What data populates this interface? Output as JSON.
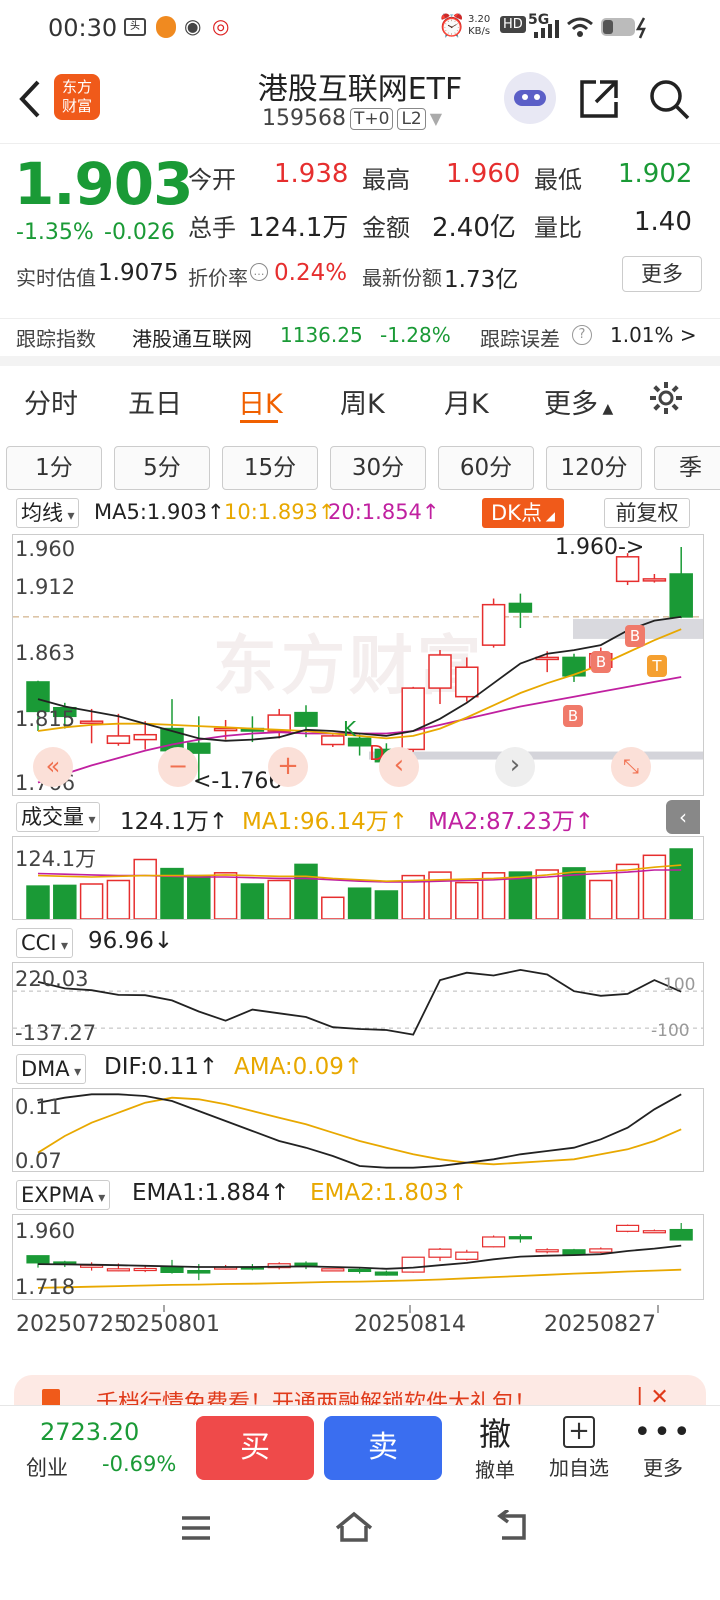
{
  "status": {
    "time": "00:30",
    "net_speed_top": "3.20",
    "net_speed_bot": "KB/s",
    "hd": "HD",
    "signal": "5G"
  },
  "header": {
    "logo_line1": "东方",
    "logo_line2": "财富",
    "title": "港股互联网ETF",
    "code": "159568",
    "tag1": "T+0",
    "tag2": "L2"
  },
  "quote": {
    "price": "1.903",
    "change_pct": "-1.35%",
    "change": "-0.026",
    "open_label": "今开",
    "open": "1.938",
    "high_label": "最高",
    "high": "1.960",
    "low_label": "最低",
    "low": "1.902",
    "vol_label": "总手",
    "vol": "124.1万",
    "amt_label": "金额",
    "amt": "2.40亿",
    "ratio_label": "量比",
    "ratio": "1.40",
    "iopv_label": "实时估值",
    "iopv": "1.9075",
    "premium_label": "折价率",
    "premium": "0.24%",
    "shares_label": "最新份额",
    "shares": "1.73亿",
    "more": "更多"
  },
  "track": {
    "label": "跟踪指数",
    "index": "港股通互联网",
    "value": "1136.25",
    "change": "-1.28%",
    "err_label": "跟踪误差",
    "err": "1.01% >"
  },
  "tabs": [
    "分时",
    "五日",
    "日K",
    "周K",
    "月K",
    "更多"
  ],
  "periods": [
    "1分",
    "5分",
    "15分",
    "30分",
    "60分",
    "120分",
    "季"
  ],
  "kline": {
    "selector": "均线",
    "ma5": "MA5:1.903↑",
    "ma10": "10:1.893↑",
    "ma20": "20:1.854↑",
    "dk": "DK点",
    "adj": "前复权",
    "y_top": "1.960",
    "y2": "1.912",
    "y3": "1.863",
    "y4": "1.815",
    "y_bot": "1.766",
    "hi_note": "1.960->",
    "lo_note": "<-1.766",
    "k_mark": "K",
    "d_mark": "D",
    "b_mark": "B",
    "t_mark": "T",
    "watermark": "东方财富"
  },
  "volume": {
    "selector": "成交量",
    "value": "124.1万↑",
    "ma1": "MA1:96.14万↑",
    "ma2": "MA2:87.23万↑",
    "y_top": "124.1万"
  },
  "cci": {
    "selector": "CCI",
    "value": "96.96↓",
    "y_top": "220.03",
    "y_bot": "-137.27",
    "r_top": "100",
    "r_bot": "-100"
  },
  "dma": {
    "selector": "DMA",
    "dif": "DIF:0.11↑",
    "ama": "AMA:0.09↑",
    "y_top": "0.11",
    "y_bot": "0.07"
  },
  "expma": {
    "selector": "EXPMA",
    "ema1": "EMA1:1.884↑",
    "ema2": "EMA2:1.803↑",
    "y_top": "1.960",
    "y_bot": "1.718"
  },
  "dates": [
    "20250725",
    "20250801",
    "20250814",
    "20250827"
  ],
  "banner": {
    "text": "千档行情免费看！开通两融解锁软件大礼包！"
  },
  "bottom": {
    "index_value": "2723.20",
    "index_name": "创业",
    "index_change": "-0.69%",
    "buy": "买",
    "sell": "卖",
    "cancel_big": "撤",
    "cancel": "撤单",
    "add": "加自选",
    "more": "更多"
  },
  "colors": {
    "up": "#e62e2e",
    "down": "#1a9a36",
    "ma5": "#222222",
    "ma10": "#e8a800",
    "ma20": "#c020a0",
    "accent": "#f06000",
    "buy": "#ef4a4a",
    "sell": "#3a6ef0"
  },
  "chart_data": {
    "type": "candlestick",
    "dates_shown": [
      "20250725",
      "20250801",
      "20250814",
      "20250827"
    ],
    "ylim": [
      1.766,
      1.96
    ],
    "candles": [
      {
        "o": 1.85,
        "c": 1.826,
        "h": 1.851,
        "l": 1.81
      },
      {
        "o": 1.829,
        "c": 1.822,
        "h": 1.833,
        "l": 1.812
      },
      {
        "o": 1.818,
        "c": 1.818,
        "h": 1.828,
        "l": 1.8
      },
      {
        "o": 1.8,
        "c": 1.806,
        "h": 1.824,
        "l": 1.798
      },
      {
        "o": 1.803,
        "c": 1.807,
        "h": 1.818,
        "l": 1.795
      },
      {
        "o": 1.812,
        "c": 1.794,
        "h": 1.836,
        "l": 1.79
      },
      {
        "o": 1.8,
        "c": 1.792,
        "h": 1.822,
        "l": 1.768
      },
      {
        "o": 1.811,
        "c": 1.812,
        "h": 1.819,
        "l": 1.803
      },
      {
        "o": 1.812,
        "c": 1.81,
        "h": 1.822,
        "l": 1.801
      },
      {
        "o": 1.81,
        "c": 1.823,
        "h": 1.828,
        "l": 1.804
      },
      {
        "o": 1.825,
        "c": 1.814,
        "h": 1.831,
        "l": 1.805
      },
      {
        "o": 1.799,
        "c": 1.806,
        "h": 1.807,
        "l": 1.797
      },
      {
        "o": 1.804,
        "c": 1.798,
        "h": 1.807,
        "l": 1.79
      },
      {
        "o": 1.795,
        "c": 1.785,
        "h": 1.8,
        "l": 1.783
      },
      {
        "o": 1.795,
        "c": 1.845,
        "h": 1.846,
        "l": 1.793
      },
      {
        "o": 1.845,
        "c": 1.872,
        "h": 1.876,
        "l": 1.832
      },
      {
        "o": 1.838,
        "c": 1.862,
        "h": 1.87,
        "l": 1.834
      },
      {
        "o": 1.88,
        "c": 1.913,
        "h": 1.918,
        "l": 1.878
      },
      {
        "o": 1.914,
        "c": 1.907,
        "h": 1.922,
        "l": 1.894
      },
      {
        "o": 1.87,
        "c": 1.87,
        "h": 1.875,
        "l": 1.858
      },
      {
        "o": 1.87,
        "c": 1.855,
        "h": 1.873,
        "l": 1.85
      },
      {
        "o": 1.862,
        "c": 1.873,
        "h": 1.878,
        "l": 1.859
      },
      {
        "o": 1.932,
        "c": 1.952,
        "h": 1.955,
        "l": 1.929
      },
      {
        "o": 1.934,
        "c": 1.934,
        "h": 1.938,
        "l": 1.931
      },
      {
        "o": 1.938,
        "c": 1.903,
        "h": 1.96,
        "l": 1.902
      }
    ],
    "ma5": [
      1.836,
      1.83,
      1.826,
      1.822,
      1.816,
      1.81,
      1.804,
      1.802,
      1.803,
      1.805,
      1.811,
      1.81,
      1.808,
      1.806,
      1.81,
      1.82,
      1.833,
      1.849,
      1.865,
      1.873,
      1.876,
      1.88,
      1.892,
      1.9,
      1.903
    ],
    "ma10": [
      1.81,
      1.813,
      1.815,
      1.816,
      1.816,
      1.815,
      1.814,
      1.813,
      1.812,
      1.811,
      1.81,
      1.808,
      1.806,
      1.804,
      1.806,
      1.812,
      1.821,
      1.831,
      1.841,
      1.849,
      1.856,
      1.864,
      1.874,
      1.884,
      1.893
    ],
    "ma20": [
      1.768,
      1.775,
      1.782,
      1.788,
      1.794,
      1.799,
      1.803,
      1.806,
      1.808,
      1.809,
      1.808,
      1.808,
      1.808,
      1.808,
      1.81,
      1.815,
      1.82,
      1.825,
      1.83,
      1.834,
      1.838,
      1.842,
      1.846,
      1.85,
      1.854
    ],
    "volume": [
      0.47,
      0.48,
      0.5,
      0.55,
      0.85,
      0.72,
      0.62,
      0.66,
      0.5,
      0.55,
      0.78,
      0.31,
      0.44,
      0.4,
      0.62,
      0.67,
      0.52,
      0.66,
      0.67,
      0.7,
      0.73,
      0.55,
      0.78,
      0.91,
      1.0
    ],
    "vol_ma1": [
      0.62,
      0.61,
      0.6,
      0.61,
      0.62,
      0.62,
      0.62,
      0.63,
      0.62,
      0.61,
      0.61,
      0.58,
      0.56,
      0.54,
      0.55,
      0.56,
      0.57,
      0.58,
      0.6,
      0.63,
      0.67,
      0.68,
      0.7,
      0.74,
      0.77
    ],
    "vol_ma2": [
      0.65,
      0.64,
      0.63,
      0.62,
      0.62,
      0.61,
      0.6,
      0.6,
      0.59,
      0.58,
      0.58,
      0.56,
      0.54,
      0.53,
      0.53,
      0.54,
      0.55,
      0.56,
      0.58,
      0.6,
      0.63,
      0.65,
      0.67,
      0.7,
      0.7
    ],
    "cci": [
      150,
      115,
      105,
      80,
      78,
      50,
      -10,
      -60,
      0,
      -20,
      -40,
      -95,
      -105,
      -110,
      -135,
      160,
      200,
      185,
      215,
      190,
      100,
      75,
      85,
      160,
      97
    ],
    "dif": [
      0.105,
      0.108,
      0.11,
      0.11,
      0.109,
      0.106,
      0.1,
      0.094,
      0.088,
      0.082,
      0.078,
      0.073,
      0.067,
      0.066,
      0.066,
      0.067,
      0.069,
      0.071,
      0.074,
      0.076,
      0.078,
      0.083,
      0.09,
      0.101,
      0.11
    ],
    "ama": [
      0.075,
      0.085,
      0.093,
      0.099,
      0.105,
      0.108,
      0.107,
      0.104,
      0.1,
      0.096,
      0.092,
      0.087,
      0.082,
      0.078,
      0.074,
      0.071,
      0.069,
      0.068,
      0.069,
      0.07,
      0.071,
      0.074,
      0.077,
      0.082,
      0.089
    ],
    "ema1": [
      1.822,
      1.821,
      1.82,
      1.818,
      1.816,
      1.814,
      1.812,
      1.812,
      1.812,
      1.813,
      1.814,
      1.812,
      1.81,
      1.806,
      1.81,
      1.818,
      1.826,
      1.838,
      1.847,
      1.85,
      1.852,
      1.855,
      1.866,
      1.874,
      1.884
    ],
    "ema2": [
      1.742,
      1.744,
      1.746,
      1.748,
      1.75,
      1.752,
      1.753,
      1.755,
      1.756,
      1.758,
      1.76,
      1.762,
      1.763,
      1.765,
      1.767,
      1.77,
      1.774,
      1.778,
      1.782,
      1.786,
      1.79,
      1.793,
      1.797,
      1.8,
      1.803
    ]
  }
}
